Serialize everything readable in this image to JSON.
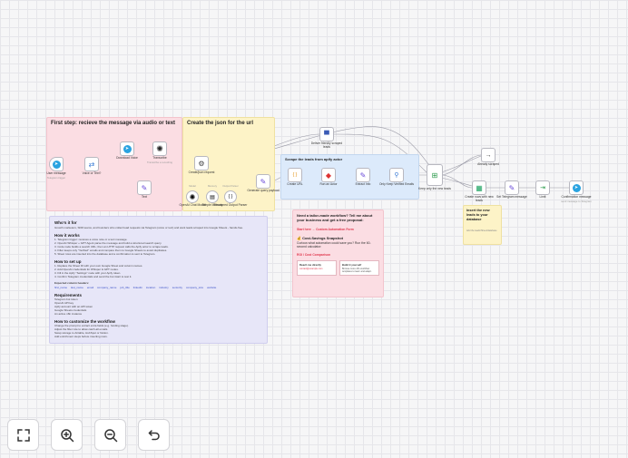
{
  "stickies": {
    "first_step": "First step: recieve the message via audio or text",
    "create_json": "Create the json for the url",
    "scrape_leads": "Scrape the leads from apify actor",
    "insert_leads": "Insert the new leads to your database",
    "insert_leads_sub": "Add the leads/Sheet/database"
  },
  "nodes": {
    "tg_trigger": "User message",
    "tg_trigger_sub": "Telegram trigger",
    "voice_or_text": "Voice or Text?",
    "download_voice": "Download Voice",
    "transcribe": "Transcribe",
    "text": "Text",
    "transcribe_sub": "Transcribe a recording",
    "create_json": "Create/json request",
    "openai_chat": "OpenAI Chat Model",
    "simple_memory": "Simple Memory",
    "structured_parser": "Structured Output Parser",
    "model_label": "Model",
    "memory_label": "Memory",
    "parser_label": "Output Parser",
    "generate_query": "Generate query payload",
    "deliver_content": "Deliver friendly scraped leads",
    "create_url": "Create URL",
    "run_actor": "Run an Actor",
    "extract_info": "Extract Info",
    "only_keep": "Only Keep Verified Emails",
    "keep_new": "Keep only the new leads",
    "already_scraped": "Already scraped",
    "create_rows": "Create rows with new leads",
    "get_message": "Set Telegram message",
    "limit": "Limit",
    "confirm": "Confirmation message",
    "confirm_sub": "send message to Telegram"
  },
  "guide": {
    "title": "Who's it for",
    "intro": "Growth marketers, SDR teams, and founders who collect lead requests via Telegram (voice or text) and want leads scraped into Google Sheets - hands-free.",
    "works_title": "How it works",
    "works_lines": [
      "1. Telegram trigger: receives a voice note or a text message.",
      "2. OpenAI Whisper + GPT Agent parse the message and build a structured search query.",
      "3. Code node builds a search URL; then an HTTP request calls the Apify actor to scrape leads.",
      "4. Filter keeps only \"Verified\" emails and compare them to Google Sheets to avoid duplicates.",
      "5. Sheet rows are inserted into the database and a confirmation is sent to Telegram."
    ],
    "setup_title": "How to set up",
    "setup_lines": [
      "1. Replace the Sheet ID with your own Google Sheet and column names.",
      "2. Add OpenAI credentials for Whisper & GPT nodes.",
      "3. Fill in the Apify \"Settings\" node with your Apify token.",
      "4. Confirm Telegram credentials and send the bot /start to test it."
    ],
    "columns_title": "Expected column headers:",
    "columns": [
      "first_name",
      "last_name",
      "email",
      "company_name",
      "job_title",
      "linkedin",
      "location",
      "industry",
      "seniority",
      "company_size",
      "website"
    ],
    "req_title": "Requirements",
    "req_lines": [
      "Telegram bot token",
      "OpenAI API key",
      "Apify account with an API token",
      "Google Sheets credentials",
      "An active n8n instance"
    ],
    "customize_title": "How to customize the workflow",
    "customize_lines": [
      "Change the prompt to extract extra fields (e.g. funding stage).",
      "Adjust the filter rule to allow catch-all emails.",
      "Swap storage to Airtable, HubSpot or Notion.",
      "Add enrichment steps before inserting rows."
    ]
  },
  "promo": {
    "title": "Need a tailor-made workflow? Tell me about your business and get a free proposal:",
    "link1": "Start here → Custom Automation Form",
    "subhead": "💰 Cost-Savings Snapshot",
    "body": "Curious what automation could save you? Run the 60-second calculator:",
    "link2": "ROI / Cost Comparison",
    "card1_title": "Reach me directly",
    "card1_link": "contact@example.com",
    "card2_title": "Build it yourself",
    "card2_body": "Browse more n8n workflow templates to learn and adapt."
  },
  "toolbar": {
    "fit": "fit-view-icon",
    "zoom_in": "zoom-in-icon",
    "zoom_out": "zoom-out-icon",
    "reset": "reset-zoom-icon"
  },
  "colors": {
    "pink": "#fbdde3",
    "yellow": "#fdf3c7",
    "blue": "#dceafb",
    "lavender": "#e7e6f8",
    "red_text": "#e0384e"
  }
}
